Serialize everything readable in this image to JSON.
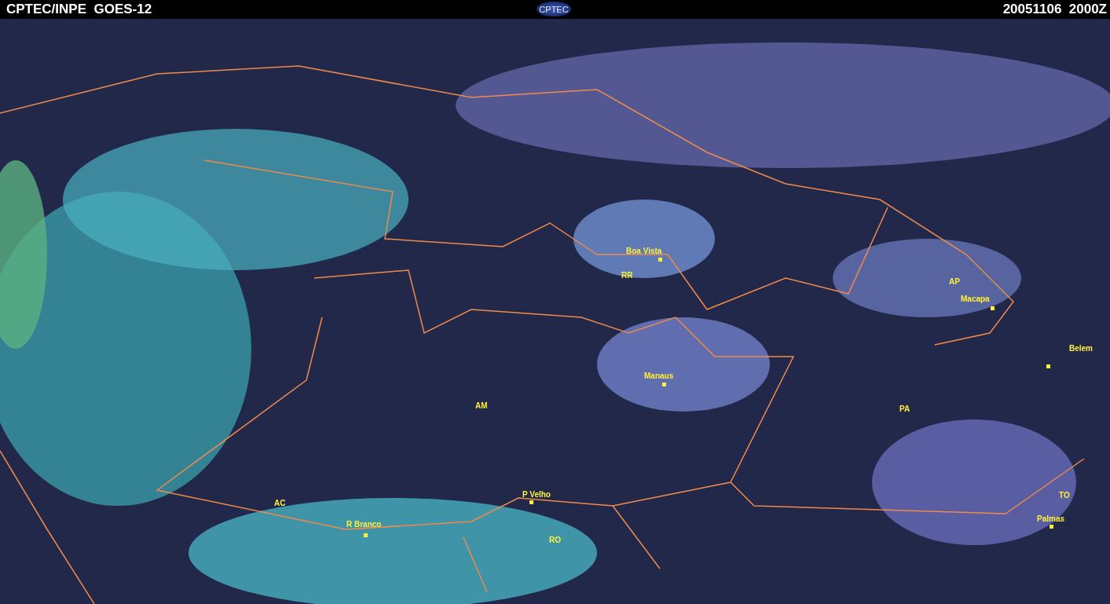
{
  "header": {
    "title": "CPTEC/INPE  GOES-12",
    "logo": "CPTEC",
    "timestamp": "20051106  2000Z"
  },
  "map": {
    "labels": [
      {
        "text": "Boa Vista",
        "kind": "city"
      },
      {
        "text": "RR",
        "kind": "state"
      },
      {
        "text": "AP",
        "kind": "state"
      },
      {
        "text": "Macapa",
        "kind": "city"
      },
      {
        "text": "Belem",
        "kind": "city"
      },
      {
        "text": "Manaus",
        "kind": "city"
      },
      {
        "text": "AM",
        "kind": "state"
      },
      {
        "text": "PA",
        "kind": "state"
      },
      {
        "text": "P Velho",
        "kind": "city"
      },
      {
        "text": "AC",
        "kind": "state"
      },
      {
        "text": "R Branco",
        "kind": "city"
      },
      {
        "text": "RO",
        "kind": "state"
      },
      {
        "text": "TO",
        "kind": "state"
      },
      {
        "text": "Palmas",
        "kind": "city"
      }
    ]
  }
}
